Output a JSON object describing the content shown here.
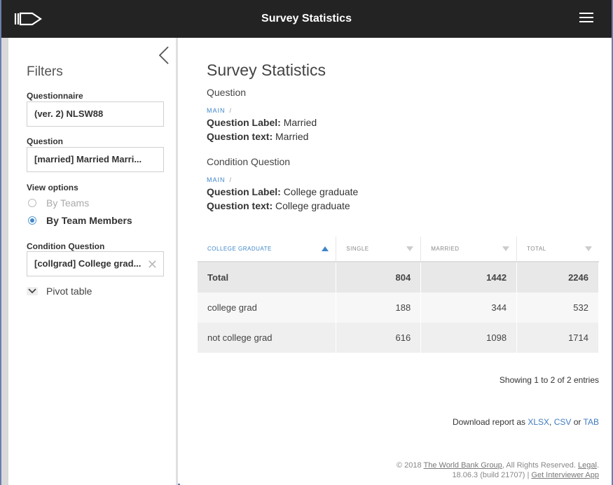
{
  "app": {
    "title": "Survey Statistics"
  },
  "sidebar": {
    "filters_title": "Filters",
    "questionnaire_label": "Questionnaire",
    "questionnaire_value": "(ver. 2) NLSW88",
    "question_label": "Question",
    "question_value": "[married] Married Marri...",
    "view_options_label": "View options",
    "view_options": [
      {
        "label": "By Teams",
        "selected": false
      },
      {
        "label": "By Team Members",
        "selected": true
      }
    ],
    "condition_label": "Condition Question",
    "condition_value": "[collgrad] College grad...",
    "pivot_label": "Pivot table"
  },
  "main": {
    "heading": "Survey Statistics",
    "question_section": "Question",
    "question_crumb": "MAIN",
    "question_label_key": "Question Label:",
    "question_label_val": "Married",
    "question_text_key": "Question text:",
    "question_text_val": "Married",
    "condition_section": "Condition Question",
    "condition_crumb": "MAIN",
    "condition_label_key": "Question Label:",
    "condition_label_val": "College graduate",
    "condition_text_key": "Question text:",
    "condition_text_val": "College graduate"
  },
  "table": {
    "columns": [
      "COLLEGE GRADUATE",
      "SINGLE",
      "MARRIED",
      "TOTAL"
    ],
    "total_row": [
      "Total",
      "804",
      "1442",
      "2246"
    ],
    "rows": [
      [
        "college grad",
        "188",
        "344",
        "532"
      ],
      [
        "not college grad",
        "616",
        "1098",
        "1714"
      ]
    ]
  },
  "entries": "Showing 1 to 2 of 2 entries",
  "download": {
    "prefix": "Download report as",
    "xlsx": "XLSX",
    "sep1": ",",
    "csv": "CSV",
    "or": "or",
    "tab": "TAB"
  },
  "footer": {
    "copyright": "© 2018",
    "org": "The World Bank Group",
    "rights": ", All Rights Reserved.",
    "legal": "Legal",
    "dot": ".",
    "version": "18.06.3 (build 21707) |",
    "app_link": "Get Interviewer App"
  }
}
